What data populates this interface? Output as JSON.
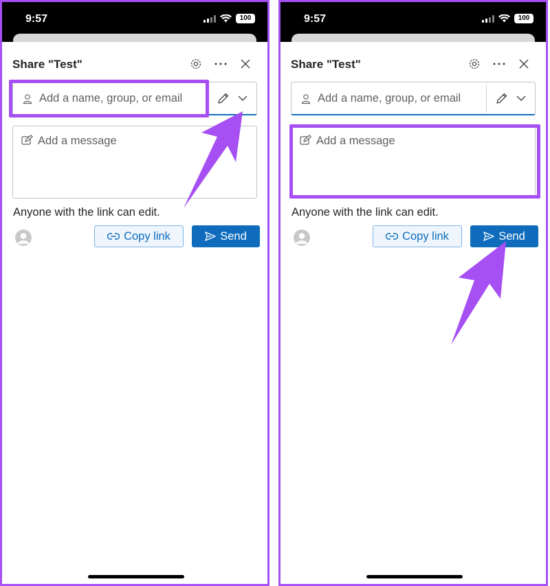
{
  "colors": {
    "accent": "#a64ff3",
    "primary": "#0f6cbd",
    "text": "#242424",
    "placeholder": "#616161"
  },
  "panels": [
    {
      "status": {
        "time": "9:57",
        "battery": "100"
      },
      "dialog": {
        "title": "Share \"Test\"",
        "recipient_placeholder": "Add a name, group, or email",
        "message_placeholder": "Add a message",
        "link_info": "Anyone with the link can edit.",
        "copy_link": "Copy link",
        "send": "Send"
      },
      "annotation": "Recipient field highlighted; arrow points to the permissions dropdown"
    },
    {
      "status": {
        "time": "9:57",
        "battery": "100"
      },
      "dialog": {
        "title": "Share \"Test\"",
        "recipient_placeholder": "Add a name, group, or email",
        "message_placeholder": "Add a message",
        "link_info": "Anyone with the link can edit.",
        "copy_link": "Copy link",
        "send": "Send"
      },
      "annotation": "Message field highlighted; arrow points to the Send button"
    }
  ]
}
